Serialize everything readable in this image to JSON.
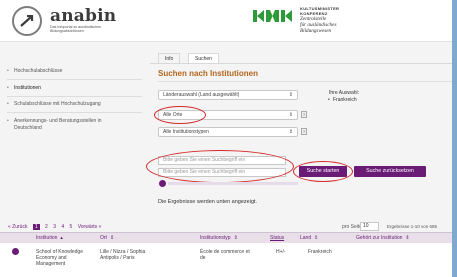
{
  "header": {
    "brand_name": "anabin",
    "brand_sub": "Das Infoportal zu ausländischen Bildungsabschlüssen",
    "kmk_line1": "KULTUSMINISTER",
    "kmk_line2": "KONFERENZ",
    "kmk_line3": "Zentralstelle",
    "kmk_line4": "für ausländisches",
    "kmk_line5": "Bildungswesen"
  },
  "tabs": [
    {
      "label": "Info"
    },
    {
      "label": "Suchen"
    }
  ],
  "sidebar": {
    "items": [
      {
        "label": "Hochschulabschlüsse"
      },
      {
        "label": "Institutionen"
      },
      {
        "label": "Schulabschlüsse mit Hochschulzugang"
      },
      {
        "label": "Anerkennungs- und Beratungsstellen in Deutschland"
      }
    ]
  },
  "search": {
    "title": "Suchen nach Institutionen",
    "country_select": "Länderauswahl (Land ausgewählt)",
    "city_select": "Alle Orte",
    "type_select": "Alle Institutionstypen",
    "selection_label": "Ihre Auswahl:",
    "selection_item": "Frankreich",
    "term_placeholder_1": "Bitte geben Sie einen Suchbegriff ein",
    "term_placeholder_2": "Bitte geben Sie einen Suchbegriff ein",
    "start_button": "Suche starten",
    "reset_button": "Suche zurücksetzen",
    "result_note": "Die Ergebnisse werden unten angezeigt."
  },
  "pager": {
    "back": "« Zurück",
    "pages": [
      "1",
      "2",
      "3",
      "4",
      "5"
    ],
    "current_page": "1",
    "forward": "Vorwärts »",
    "per_page_label": "pro Seite",
    "per_page_value": "10",
    "results_count": "Ergebnisse 1-10 von 685"
  },
  "table": {
    "columns": [
      "Institution",
      "Ort",
      "Institutionstyp",
      "Status",
      "Land",
      "Gehört zur Institution"
    ],
    "rows": [
      {
        "institution": "School of Knowledge Economy and Management",
        "ort": "Lille / Nizza / Sophia Antipolis / Paris",
        "typ": "École de commerce et de",
        "status": "H+/-",
        "land": "Frankreich",
        "gehoert": ""
      }
    ]
  },
  "colors": {
    "accent": "#6a1b76",
    "title": "#b3651c",
    "annotation": "#d42a2a",
    "strip": "#7ea9cf"
  }
}
